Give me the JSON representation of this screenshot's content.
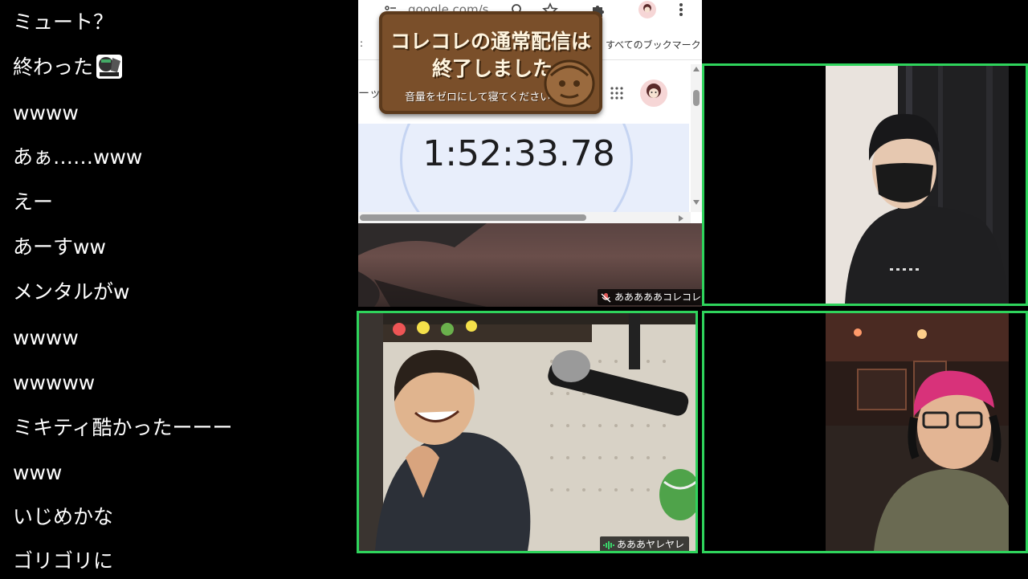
{
  "chat": {
    "messages": [
      "ミュート？",
      "終わった",
      "wwww",
      "あぁ……www",
      "えー",
      "あーすww",
      "メンタルがw",
      "wwww",
      "wwwww",
      "ミキティ酷かったーーー",
      "www",
      "いじめかな",
      "ゴリゴリに"
    ]
  },
  "browser": {
    "address": "google.com/s...",
    "bookmarks_label": "すべてのブックマーク",
    "sub_row_text": "ーッ",
    "timer_value": "1:52:33.78"
  },
  "overlay": {
    "title_line1": "コレコレの通常配信は",
    "title_line2": "終了しました",
    "subtitle": "音量をゼロにして寝てください"
  },
  "participants": {
    "screen_share_name": "あああああコレコレ",
    "bottom_left_name": "あああヤレヤレ"
  },
  "colors": {
    "active_border": "#2fd45c",
    "background": "#000000",
    "board_wood": "#7a4f2a"
  }
}
